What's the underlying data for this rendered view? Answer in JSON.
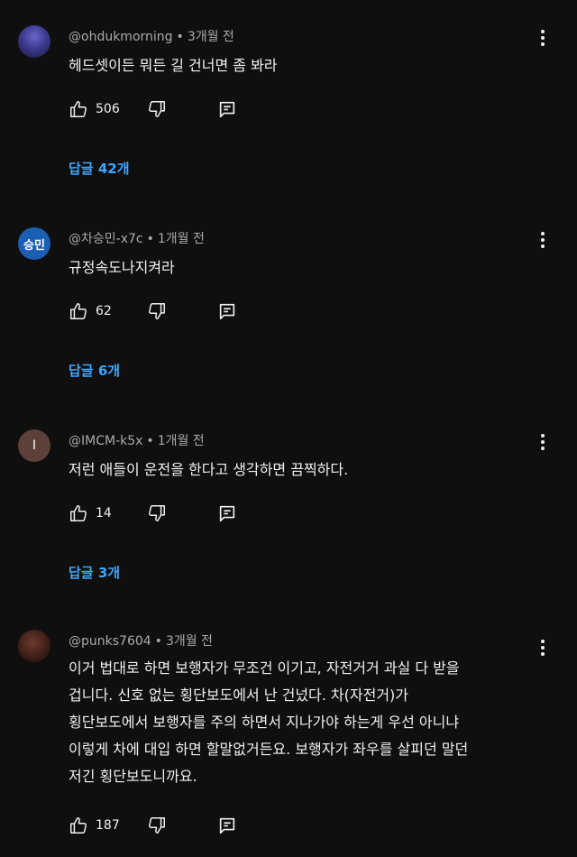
{
  "comments": [
    {
      "author": "@ohdukmorning",
      "time": "3개월 전",
      "avatar_initial": "",
      "text": "헤드셋이든 뭐든 길 건너면 좀 봐라",
      "likes": "506",
      "replies": "답글 42개"
    },
    {
      "author": "@차승민-x7c",
      "time": "1개월 전",
      "avatar_initial": "승민",
      "text": "규정속도나지켜라",
      "likes": "62",
      "replies": "답글 6개"
    },
    {
      "author": "@IMCM-k5x",
      "time": "1개월 전",
      "avatar_initial": "I",
      "text": "저런 애들이 운전을 한다고 생각하면 끔찍하다.",
      "likes": "14",
      "replies": "답글 3개"
    },
    {
      "author": "@punks7604",
      "time": "3개월 전",
      "avatar_initial": "",
      "text_lines": [
        "이거 법대로 하면 보행자가 무조건 이기고, 자전거거 과실 다 받을",
        "겁니다. 신호 없는 횡단보도에서 난 건넜다. 차(자전거)가",
        "횡단보도에서 보행자를 주의 하면서 지나가야 하는게 우선 아니냐",
        "이렇게 차에 대입 하면 할말없거든요. 보행자가 좌우를 살피던 말던",
        "저긴 횡단보도니까요."
      ],
      "likes": "187"
    }
  ],
  "icons": {
    "like": "thumbs-up-icon",
    "dislike": "thumbs-down-icon",
    "reply": "reply-icon",
    "more": "more-vert-icon"
  },
  "colors": {
    "background": "#0f0f0f",
    "text": "#f1f1f1",
    "meta": "#aaaaaa",
    "reply_link": "#3ea6ff"
  }
}
